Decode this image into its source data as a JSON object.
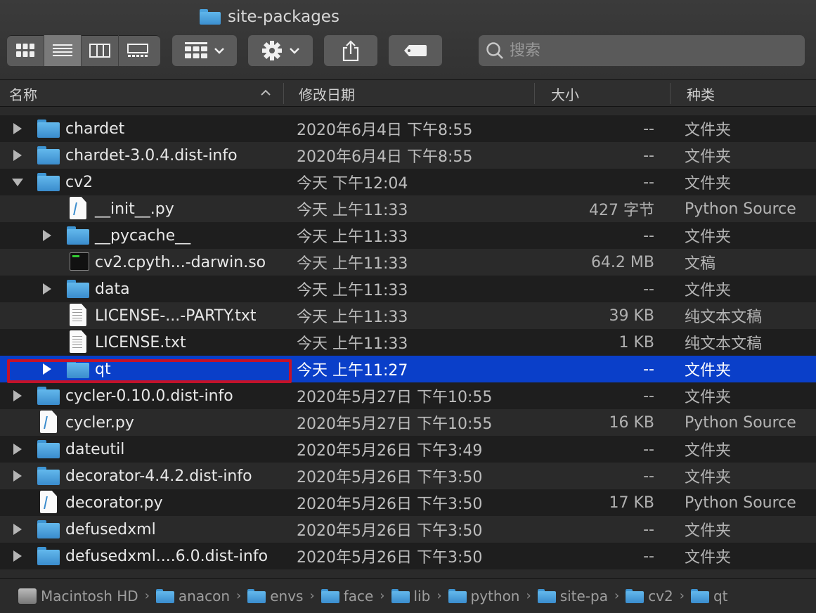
{
  "window": {
    "title": "site-packages"
  },
  "toolbar": {
    "view_modes": [
      "icon-view",
      "list-view",
      "column-view",
      "gallery-view"
    ],
    "search_placeholder": "搜索"
  },
  "columns": {
    "name": "名称",
    "date": "修改日期",
    "size": "大小",
    "kind": "种类"
  },
  "rows": [
    {
      "name": "chardet",
      "date": "2020年6月4日 下午8:55",
      "size": "--",
      "kind": "文件夹",
      "type": "folder",
      "indent": 0,
      "disclosure": "collapsed"
    },
    {
      "name": "chardet-3.0.4.dist-info",
      "date": "2020年6月4日 下午8:55",
      "size": "--",
      "kind": "文件夹",
      "type": "folder",
      "indent": 0,
      "disclosure": "collapsed"
    },
    {
      "name": "cv2",
      "date": "今天 下午12:04",
      "size": "--",
      "kind": "文件夹",
      "type": "folder",
      "indent": 0,
      "disclosure": "expanded"
    },
    {
      "name": "__init__.py",
      "date": "今天 上午11:33",
      "size": "427 字节",
      "kind": "Python Source",
      "type": "python",
      "indent": 1,
      "disclosure": "none"
    },
    {
      "name": "__pycache__",
      "date": "今天 上午11:33",
      "size": "--",
      "kind": "文件夹",
      "type": "folder",
      "indent": 1,
      "disclosure": "collapsed"
    },
    {
      "name": "cv2.cpyth...-darwin.so",
      "date": "今天 上午11:33",
      "size": "64.2 MB",
      "kind": "文稿",
      "type": "terminal",
      "indent": 1,
      "disclosure": "none"
    },
    {
      "name": "data",
      "date": "今天 上午11:33",
      "size": "--",
      "kind": "文件夹",
      "type": "folder",
      "indent": 1,
      "disclosure": "collapsed"
    },
    {
      "name": "LICENSE-...-PARTY.txt",
      "date": "今天 上午11:33",
      "size": "39 KB",
      "kind": "纯文本文稿",
      "type": "text",
      "indent": 1,
      "disclosure": "none"
    },
    {
      "name": "LICENSE.txt",
      "date": "今天 上午11:33",
      "size": "1 KB",
      "kind": "纯文本文稿",
      "type": "text",
      "indent": 1,
      "disclosure": "none"
    },
    {
      "name": "qt",
      "date": "今天 上午11:27",
      "size": "--",
      "kind": "文件夹",
      "type": "folder",
      "indent": 1,
      "disclosure": "collapsed",
      "selected": true
    },
    {
      "name": "cycler-0.10.0.dist-info",
      "date": "2020年5月27日 下午10:55",
      "size": "--",
      "kind": "文件夹",
      "type": "folder",
      "indent": 0,
      "disclosure": "collapsed"
    },
    {
      "name": "cycler.py",
      "date": "2020年5月27日 下午10:55",
      "size": "16 KB",
      "kind": "Python Source",
      "type": "python",
      "indent": 0,
      "disclosure": "none"
    },
    {
      "name": "dateutil",
      "date": "2020年5月26日 下午3:49",
      "size": "--",
      "kind": "文件夹",
      "type": "folder",
      "indent": 0,
      "disclosure": "collapsed"
    },
    {
      "name": "decorator-4.4.2.dist-info",
      "date": "2020年5月26日 下午3:50",
      "size": "--",
      "kind": "文件夹",
      "type": "folder",
      "indent": 0,
      "disclosure": "collapsed"
    },
    {
      "name": "decorator.py",
      "date": "2020年5月26日 下午3:50",
      "size": "17 KB",
      "kind": "Python Source",
      "type": "python",
      "indent": 0,
      "disclosure": "none"
    },
    {
      "name": "defusedxml",
      "date": "2020年5月26日 下午3:50",
      "size": "--",
      "kind": "文件夹",
      "type": "folder",
      "indent": 0,
      "disclosure": "collapsed"
    },
    {
      "name": "defusedxml....6.0.dist-info",
      "date": "2020年5月26日 下午3:50",
      "size": "--",
      "kind": "文件夹",
      "type": "folder",
      "indent": 0,
      "disclosure": "collapsed"
    }
  ],
  "pathbar": [
    "Macintosh HD",
    "anacon",
    "envs",
    "face",
    "lib",
    "python",
    "site-pa",
    "cv2",
    "qt"
  ],
  "colors": {
    "selection": "#0a3fc9",
    "highlight_border": "#c4122a",
    "folder": "#4aa3df"
  }
}
